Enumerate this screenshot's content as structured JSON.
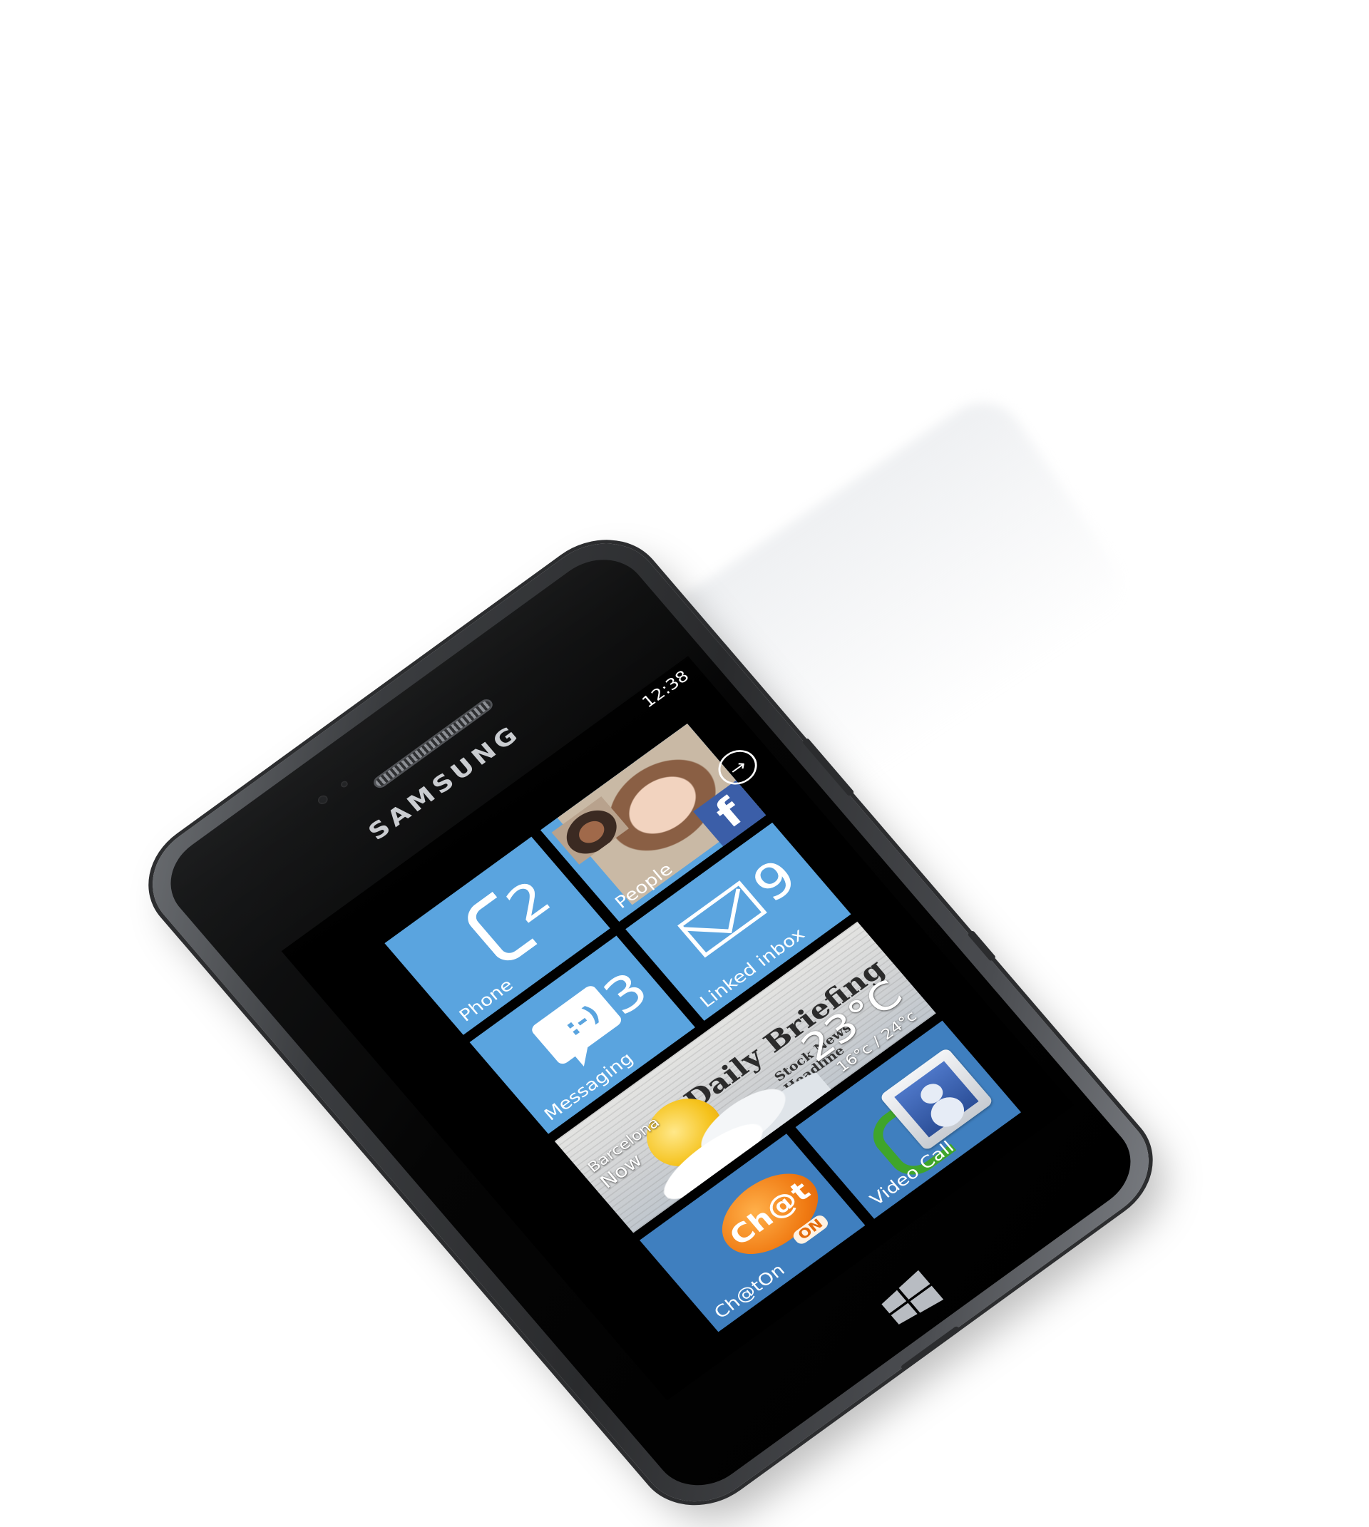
{
  "device": {
    "brand": "SAMSUNG",
    "os_logo": "windows-logo"
  },
  "status_bar": {
    "time": "12:38"
  },
  "tiles": {
    "phone": {
      "label": "Phone",
      "count": "2",
      "icon": "phone-handset-icon",
      "color": "#5aa4df"
    },
    "people": {
      "label": "People",
      "icon": "facebook-icon",
      "fb_glyph": "f",
      "color": "#5aa4df"
    },
    "messaging": {
      "label": "Messaging",
      "count": "3",
      "icon": "smiley-bubble-icon",
      "face": ":-)",
      "color": "#5aa4df"
    },
    "linked_inbox": {
      "label": "Linked inbox",
      "count": "9",
      "icon": "envelope-icon",
      "color": "#5aa4df"
    },
    "weather_news": {
      "headline": "Daily Briefing",
      "subheadline": "Stock News Headline",
      "city": "Barcelona",
      "when": "Now",
      "temperature": "23°C",
      "range": "16°c / 24°c"
    },
    "chaton": {
      "label": "Ch@tOn",
      "logo_text": "Ch@t",
      "logo_sub": "ON",
      "color": "#3f7fbf"
    },
    "video_call": {
      "label": "Video Call",
      "icon": "video-call-contact-icon",
      "color": "#3f7fbf"
    }
  },
  "navigation": {
    "arrow": "→"
  }
}
